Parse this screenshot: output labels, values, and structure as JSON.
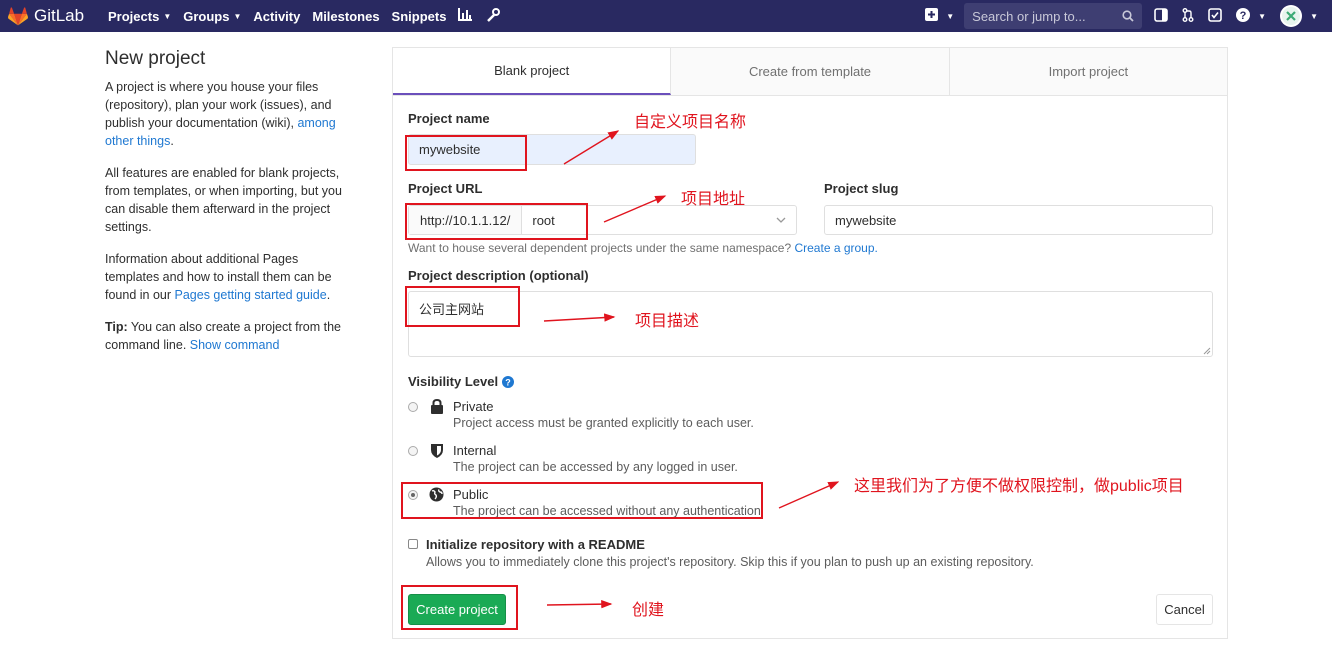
{
  "nav": {
    "brand": "GitLab",
    "items": [
      "Projects",
      "Groups",
      "Activity",
      "Milestones",
      "Snippets"
    ],
    "search_placeholder": "Search or jump to..."
  },
  "left": {
    "title": "New project",
    "p1_text": "A project is where you house your files (repository), plan your work (issues), and publish your documentation (wiki), ",
    "p1_link": "among other things",
    "p1_end": ".",
    "p2": "All features are enabled for blank projects, from templates, or when importing, but you can disable them afterward in the project settings.",
    "p3_text": "Information about additional Pages templates and how to install them can be found in our ",
    "p3_link": "Pages getting started guide",
    "p3_end": ".",
    "tip_label": "Tip:",
    "tip_text": " You can also create a project from the command line. ",
    "tip_link": "Show command"
  },
  "tabs": [
    "Blank project",
    "Create from template",
    "Import project"
  ],
  "form": {
    "project_name_label": "Project name",
    "project_name_value": "mywebsite",
    "project_url_label": "Project URL",
    "url_prefix": "http://10.1.1.12/",
    "namespace_value": "root",
    "slug_label": "Project slug",
    "slug_value": "mywebsite",
    "namespace_help": "Want to house several dependent projects under the same namespace? ",
    "namespace_help_link": "Create a group.",
    "description_label": "Project description (optional)",
    "description_value": "公司主网站",
    "visibility_label": "Visibility Level",
    "visibility": [
      {
        "title": "Private",
        "desc": "Project access must be granted explicitly to each user."
      },
      {
        "title": "Internal",
        "desc": "The project can be accessed by any logged in user."
      },
      {
        "title": "Public",
        "desc": "The project can be accessed without any authentication"
      }
    ],
    "readme_label": "Initialize repository with a README",
    "readme_desc": "Allows you to immediately clone this project's repository. Skip this if you plan to push up an existing repository.",
    "create_button": "Create project",
    "cancel_button": "Cancel"
  },
  "annotations": {
    "name": "自定义项目名称",
    "url": "项目地址",
    "description": "项目描述",
    "public": "这里我们为了方便不做权限控制，做public项目",
    "create": "创建"
  },
  "colors": {
    "navbar": "#292961",
    "accent_tab": "#6b4fbb",
    "link": "#1f78d1",
    "create_button": "#1aaa55",
    "annotation_red": "#e0141e"
  }
}
